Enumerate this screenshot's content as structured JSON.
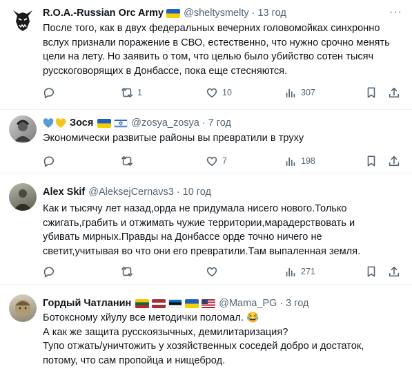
{
  "tweets": [
    {
      "name": "R.O.A.-Russian Orc Army",
      "flags": [
        "ua"
      ],
      "handle": "@sheltysmelty",
      "time": "13 год",
      "text": "После того, как в двух федеральных вечерних головомойках синхронно\nвслух признали поражение в СВО, естественно, что нужно срочно менять\nцели на лету. Но заявить о том, что целью было убийство сотен тысяч\nрусскоговорящих в Донбассе, пока еще стесняются.",
      "reply": "",
      "retweet": "1",
      "like": "10",
      "views": "307"
    },
    {
      "name": "Зося",
      "prefix_hearts": true,
      "flags": [
        "ua",
        "il"
      ],
      "handle": "@zosya_zosya",
      "time": "7 год",
      "text": "Экономически развитые районы вы превратили в труху",
      "reply": "",
      "retweet": "",
      "like": "7",
      "views": "198"
    },
    {
      "name": "Alex Skif",
      "flags": [],
      "handle": "@AleksejCernavs3",
      "time": "10 год",
      "text": "Как и тысячу лет назад,орда не придумала нисего нового.Только\nсжигать,грабить и отжимать чужие территории,марадерствовать и\nубивать мирных.Правды на Донбассе орде точно ничего не\nсветит,учитывая во что они его превратили.Там выпаленная земля.",
      "reply": "",
      "retweet": "",
      "like": "",
      "views": "271"
    },
    {
      "name": "Гордый Чатланин",
      "flags": [
        "lt",
        "lv",
        "ee",
        "ua",
        "us"
      ],
      "handle": "@Mama_PG",
      "time": "3 год",
      "text": "Ботоксному хйулу все методички поломал. 😂\nА как же защита русскоязычных, демилитаризация?\nТупо отжать/уничтожить у хозяйственных соседей добро и достаток,\nпотому, что сам пропойца и нищеброд."
    }
  ],
  "icons": {
    "reply": "reply-icon",
    "retweet": "retweet-icon",
    "like": "like-icon",
    "views": "views-icon",
    "bookmark": "bookmark-icon",
    "share": "share-icon",
    "more": "more-icon"
  },
  "colors": {
    "text": "#0f1419",
    "secondary": "#536471",
    "separator": "#eff3f4"
  }
}
